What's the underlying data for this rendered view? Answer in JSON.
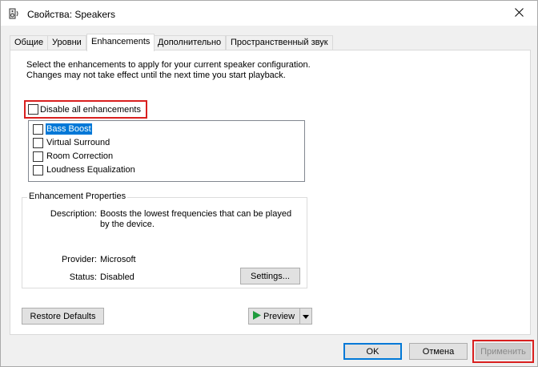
{
  "window": {
    "title": "Свойства: Speakers"
  },
  "tabs": [
    {
      "label": "Общие"
    },
    {
      "label": "Уровни"
    },
    {
      "label": "Enhancements"
    },
    {
      "label": "Дополнительно"
    },
    {
      "label": "Пространственный звук"
    }
  ],
  "enhancements": {
    "description": "Select the enhancements to apply for your current speaker configuration. Changes may not take effect until the next time you start playback.",
    "disable_all_label": "Disable all enhancements",
    "disable_all_checked": false,
    "items": [
      {
        "label": "Bass Boost",
        "checked": false,
        "selected": true
      },
      {
        "label": "Virtual Surround",
        "checked": false,
        "selected": false
      },
      {
        "label": "Room Correction",
        "checked": false,
        "selected": false
      },
      {
        "label": "Loudness Equalization",
        "checked": false,
        "selected": false
      }
    ]
  },
  "properties": {
    "group_title": "Enhancement Properties",
    "description_label": "Description:",
    "description_value": "Boosts the lowest frequencies that can be played by the device.",
    "provider_label": "Provider:",
    "provider_value": "Microsoft",
    "status_label": "Status:",
    "status_value": "Disabled",
    "settings_button": "Settings..."
  },
  "buttons": {
    "restore_defaults": "Restore Defaults",
    "preview": "Preview",
    "ok": "OK",
    "cancel": "Отмена",
    "apply": "Применить"
  },
  "colors": {
    "highlight_frame": "#d9201f",
    "selection": "#0078d7",
    "preview_play": "#1e9b3c"
  }
}
